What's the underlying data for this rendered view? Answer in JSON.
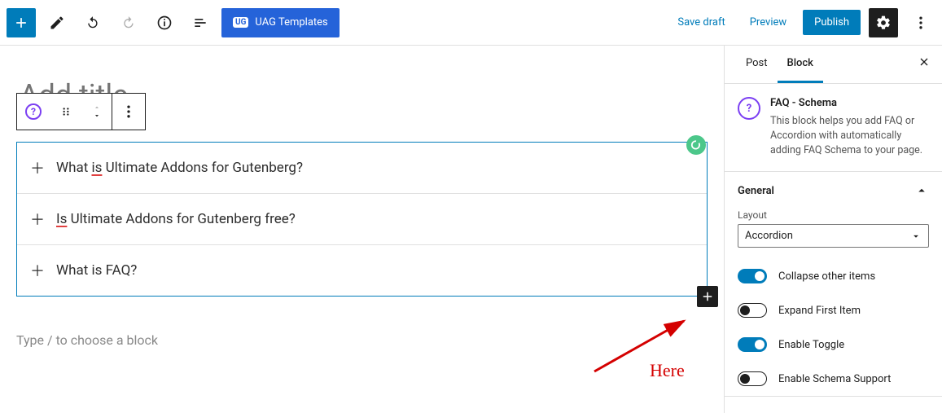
{
  "toolbar": {
    "uag_label": "UAG Templates",
    "save_draft": "Save draft",
    "preview": "Preview",
    "publish": "Publish"
  },
  "editor": {
    "title_placeholder": "Add title",
    "faq_items": [
      "What is Ultimate Addons for Gutenberg?",
      "Is Ultimate Addons for Gutenberg free?",
      "What is FAQ?"
    ],
    "type_placeholder": "Type / to choose a block"
  },
  "sidebar": {
    "tabs": {
      "post": "Post",
      "block": "Block"
    },
    "block_title": "FAQ - Schema",
    "block_desc": "This block helps you add FAQ or Accordion with automatically adding FAQ Schema to your page.",
    "general_label": "General",
    "layout_label": "Layout",
    "layout_value": "Accordion",
    "toggles": {
      "collapse": {
        "label": "Collapse other items",
        "on": true
      },
      "expand_first": {
        "label": "Expand First Item",
        "on": false
      },
      "enable_toggle": {
        "label": "Enable Toggle",
        "on": true
      },
      "enable_schema": {
        "label": "Enable Schema Support",
        "on": false
      }
    }
  },
  "annotation": {
    "here": "Here"
  },
  "colors": {
    "primary": "#007cba",
    "accent": "#2563d9",
    "purple": "#7b3ff2",
    "annotation": "#d40000"
  }
}
